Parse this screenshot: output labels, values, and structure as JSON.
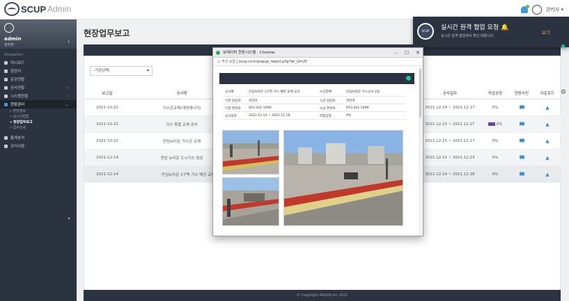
{
  "app": {
    "brand": "SCUP",
    "brand_sub": "Admin"
  },
  "topbar": {
    "user_menu": "관리자 ▾"
  },
  "sidebar": {
    "user": "admin",
    "role": "관리자",
    "nav_head": "Navigation",
    "items": [
      {
        "label": "대시보드"
      },
      {
        "label": "점관리"
      },
      {
        "label": "준공현황"
      },
      {
        "label": "공사현황"
      },
      {
        "label": "시스템현황"
      },
      {
        "label": "현장관리",
        "active": true
      }
    ],
    "sub_items": [
      "현장정보",
      "실시간협업",
      "현장업무보고",
      "업무상세"
    ],
    "extra_items": [
      {
        "label": "통계분석"
      },
      {
        "label": "공지사항"
      }
    ],
    "collapse": "«"
  },
  "main": {
    "title": "현장업무보고",
    "filter_select": "-기관선택-",
    "columns": [
      "보고일",
      "공사명",
      "공사일자",
      "작업공정",
      "현장사진",
      "다운로드"
    ],
    "rows": [
      {
        "date": "2021-10-22",
        "name": "가스관교체(대성에너지)",
        "period": "2021.12.14 ~ 2021.12.17",
        "progress": "0%"
      },
      {
        "date": "2021-10-22",
        "name": "가스 파열 교체 공사",
        "period": "2021.12.23 ~ 2021.12.27",
        "progress": "0%"
      },
      {
        "date": "2021-10-22",
        "name": "연심뉴타운 가스관 교체",
        "period": "2021.12.15 ~ 2021.12.17",
        "progress": "0%"
      },
      {
        "date": "2021-12-14",
        "name": "연심 뉴타운 도시가스 점검",
        "period": "2021.12.21 ~ 2021.12.23",
        "progress": "0%"
      },
      {
        "date": "2021-12-14",
        "name": "안심뉴타운 1구역 가스 배관 교체 공사",
        "period": "2021.12.14 ~ 2021.12.18",
        "progress": "0%"
      }
    ],
    "footer": "© Copyright ARGOS,inc 2021"
  },
  "notification": {
    "title": "실시간 원격 협업 요청",
    "subtitle": "실시간 원격 협업에서 확인 바랍니다.",
    "button": "보기",
    "logo_text": "SCUP"
  },
  "popup": {
    "window_title": "보레이허 현장시스템 - Chrome",
    "url_warn": "주의 요함",
    "url": "scup.co.kr/popup_report.php?wr_id=25",
    "info": [
      {
        "k1": "공사명",
        "v1": "안심뉴타운 1구역 가스 배관 교체 공사",
        "k2": "시공업체",
        "v2": "안심뉴타운 가스공사 1팀"
      },
      {
        "k1": "기관 담당자",
        "v1": "관리자",
        "k2": "시공 담당자",
        "v2": "관리자"
      },
      {
        "k1": "기관 연락처",
        "v1": "053-421-1999",
        "k2": "시공 연락처",
        "v2": "053-421-1999"
      },
      {
        "k1": "공사일자",
        "v1": "2021.12.14 ~ 2021.12.18",
        "k2": "작업공정",
        "v2": "0%"
      }
    ]
  },
  "colors": {
    "sidebar": "#2c3340",
    "accent": "#3d8fd6",
    "notify_btn": "#e8a13c",
    "progress": "#6e3fa6"
  }
}
